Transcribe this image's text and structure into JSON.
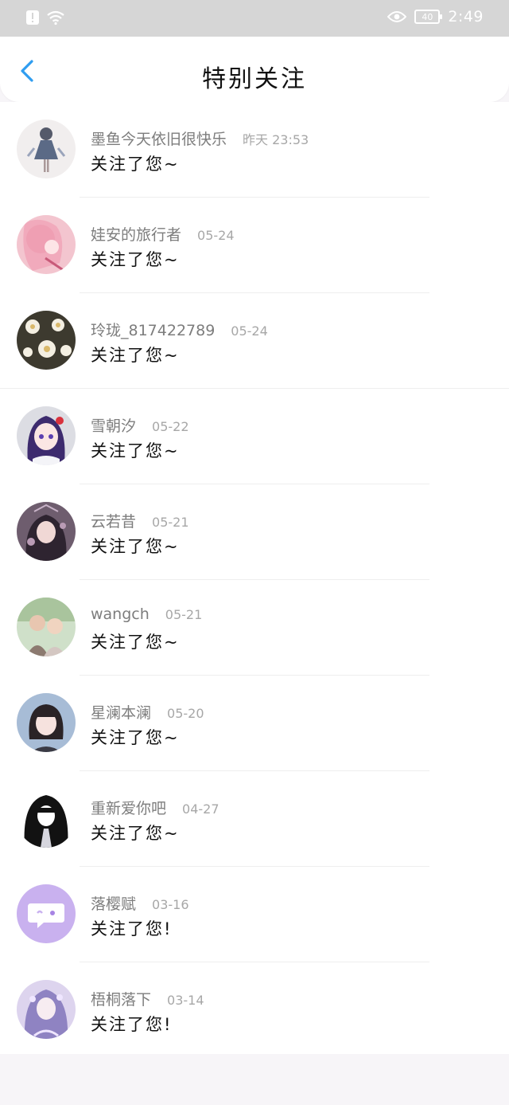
{
  "status_bar": {
    "battery": "40",
    "time": "2:49",
    "icons": [
      "alert-icon",
      "wifi-icon",
      "eye-icon",
      "battery-icon"
    ]
  },
  "header": {
    "title": "特别关注",
    "back_icon": "back-chevron-icon",
    "accent": "#2f9df0"
  },
  "items": [
    {
      "name": "墨鱼今天依旧很快乐",
      "date": "昨天 23:53",
      "message": "关注了您~",
      "avatar_icon": "avatar-girl-dress"
    },
    {
      "name": "娃安的旅行者",
      "date": "05-24",
      "message": "关注了您~",
      "avatar_icon": "avatar-pink-anime"
    },
    {
      "name": "玲珑_817422789",
      "date": "05-24",
      "message": "关注了您~",
      "avatar_icon": "avatar-flowers"
    },
    {
      "name": "雪朝汐",
      "date": "05-22",
      "message": "关注了您~",
      "avatar_icon": "avatar-purple-hair"
    },
    {
      "name": "云若昔",
      "date": "05-21",
      "message": "关注了您~",
      "avatar_icon": "avatar-dark-portrait"
    },
    {
      "name": "wangch",
      "date": "05-21",
      "message": "关注了您~",
      "avatar_icon": "avatar-photo-couple"
    },
    {
      "name": "星澜本澜",
      "date": "05-20",
      "message": "关注了您~",
      "avatar_icon": "avatar-bob-hair"
    },
    {
      "name": "重新爱你吧",
      "date": "04-27",
      "message": "关注了您~",
      "avatar_icon": "avatar-black-hair"
    },
    {
      "name": "落樱赋",
      "date": "03-16",
      "message": "关注了您!",
      "avatar_icon": "avatar-default-chat"
    },
    {
      "name": "梧桐落下",
      "date": "03-14",
      "message": "关注了您!",
      "avatar_icon": "avatar-lavender-anime"
    }
  ]
}
